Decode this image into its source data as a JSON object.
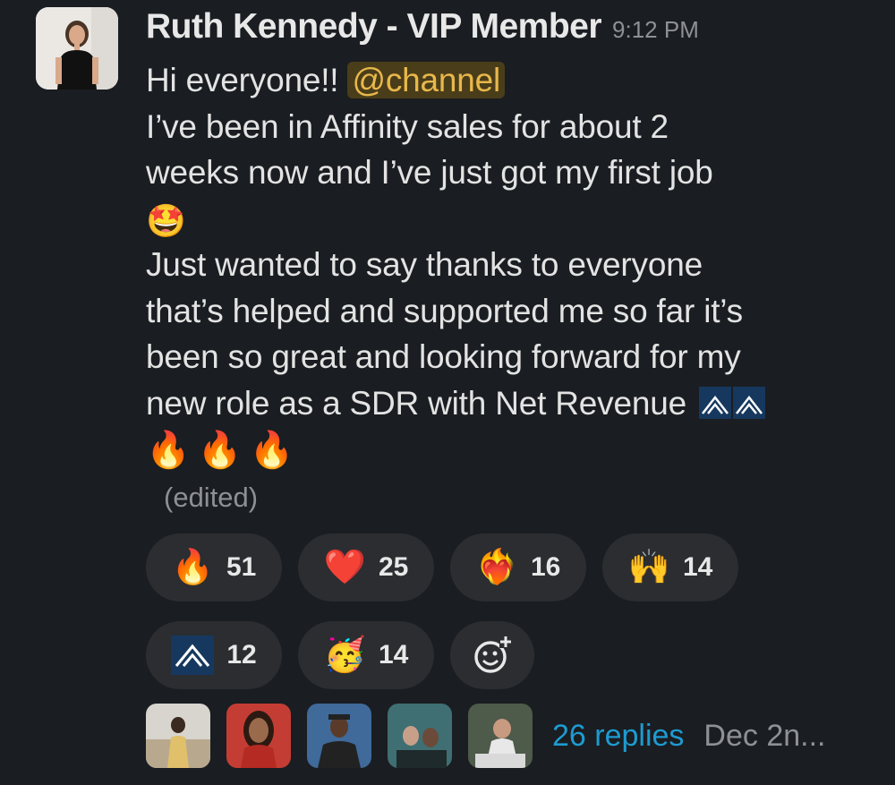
{
  "message": {
    "author": "Ruth Kennedy - VIP Member",
    "time": "9:12 PM",
    "line1_text": "Hi everyone!! ",
    "mention": "@channel",
    "line2": "I’ve been in Affinity sales for about 2",
    "line3": "weeks now and I’ve just got my first job",
    "line4": "Just wanted to say thanks to everyone",
    "line5": "that’s helped and supported me so far it’s",
    "line6": "been so great and looking forward for my",
    "line7": "new role as a SDR with Net Revenue",
    "edited": "(edited)",
    "emoji_after_job": "star-struck-icon",
    "emoji_fire": "🔥",
    "emoji_star": "🤩"
  },
  "reactions": [
    {
      "icon": "fire-icon",
      "glyph": "🔥",
      "count": "51"
    },
    {
      "icon": "heart-icon",
      "glyph": "❤️",
      "count": "25"
    },
    {
      "icon": "heart-on-fire-icon",
      "glyph": "❤️‍🔥",
      "count": "16"
    },
    {
      "icon": "raised-hands-icon",
      "glyph": "🙌",
      "count": "14"
    },
    {
      "icon": "net-revenue-logo-icon",
      "glyph": "",
      "count": "12"
    },
    {
      "icon": "partying-face-icon",
      "glyph": "🥳",
      "count": "14"
    }
  ],
  "thread": {
    "replies": "26 replies",
    "date": "Dec 2n..."
  },
  "colors": {
    "background": "#1a1d21",
    "mention_bg": "#4a3d1a",
    "mention_fg": "#e8b84a",
    "link": "#1d9bd1",
    "pill": "#2b2d31"
  }
}
